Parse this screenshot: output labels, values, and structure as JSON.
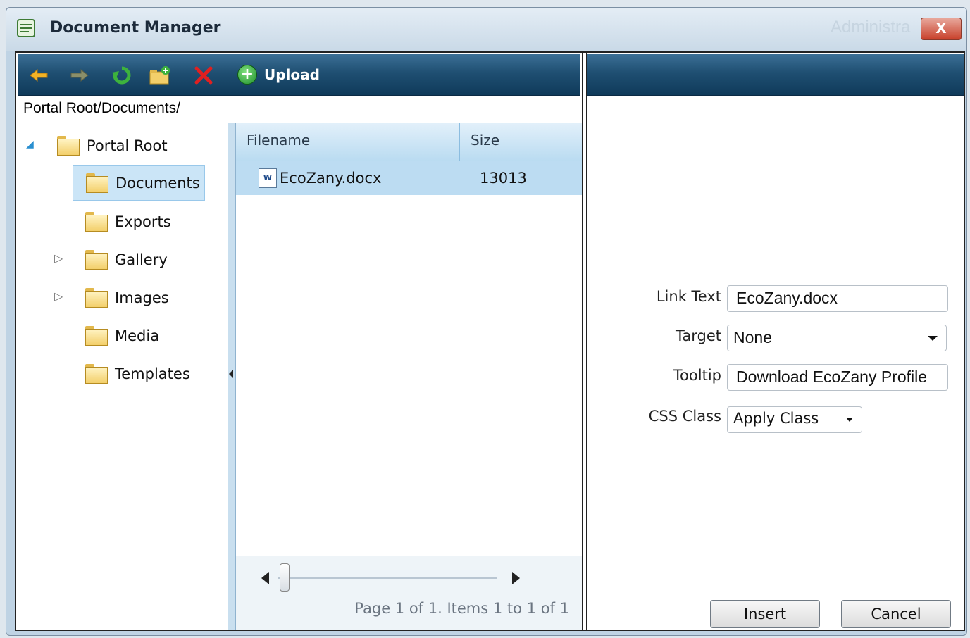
{
  "window": {
    "title": "Document Manager",
    "background_text": "Administra",
    "close_label": "X"
  },
  "toolbar": {
    "upload_label": "Upload",
    "icons": [
      "back-arrow-icon",
      "forward-arrow-icon",
      "refresh-icon",
      "new-folder-icon",
      "delete-icon",
      "upload-icon"
    ]
  },
  "path": "Portal Root/Documents/",
  "tree": {
    "root": "Portal Root",
    "items": [
      "Documents",
      "Exports",
      "Gallery",
      "Images",
      "Media",
      "Templates"
    ],
    "selected": "Documents"
  },
  "grid": {
    "columns": [
      "Filename",
      "Size"
    ],
    "rows": [
      {
        "filename": "EcoZany.docx",
        "size": "13013",
        "icon": "word-doc-icon"
      }
    ],
    "pager_info": "Page 1 of 1. Items 1 to 1 of 1"
  },
  "link_form": {
    "link_text_label": "Link Text",
    "link_text_value": "EcoZany.docx",
    "target_label": "Target",
    "target_value": "None",
    "tooltip_label": "Tooltip",
    "tooltip_value": "Download EcoZany Profile",
    "css_class_label": "CSS Class",
    "css_class_value": "Apply Class"
  },
  "buttons": {
    "insert": "Insert",
    "cancel": "Cancel"
  },
  "colors": {
    "toolbar": "#1f4f72",
    "selection": "#bcdcf2",
    "grid_header": "#b9dbf1"
  }
}
